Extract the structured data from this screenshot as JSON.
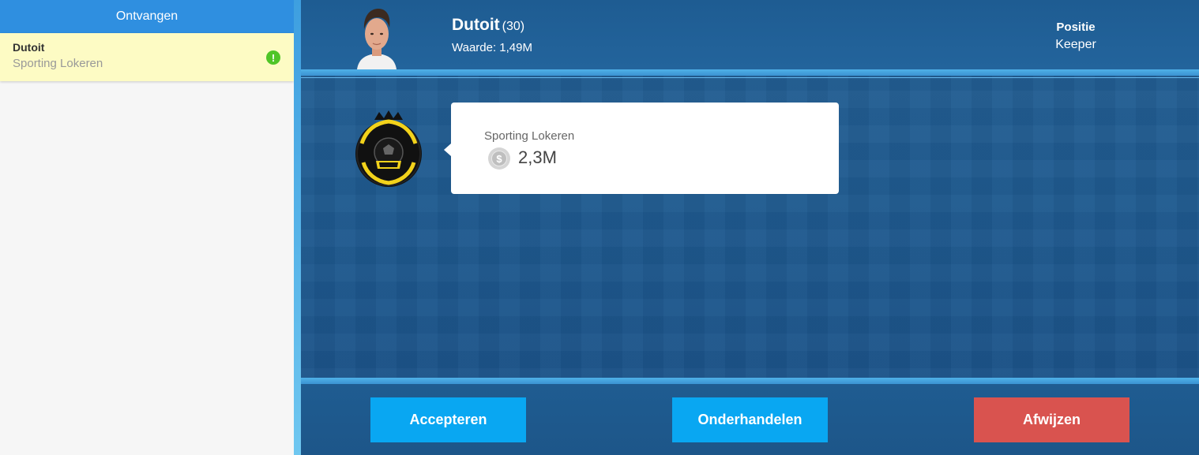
{
  "sidebar": {
    "header": "Ontvangen",
    "items": [
      {
        "name": "Dutoit",
        "club": "Sporting Lokeren",
        "status_icon": "alert-icon"
      }
    ]
  },
  "player": {
    "name": "Dutoit",
    "age": "(30)",
    "value_text": "Waarde: 1,49M",
    "position_label": "Positie",
    "position_value": "Keeper"
  },
  "offer": {
    "club": "Sporting Lokeren",
    "amount": "2,3M",
    "currency_icon": "coin-icon"
  },
  "actions": {
    "accept": "Accepteren",
    "negotiate": "Onderhandelen",
    "reject": "Afwijzen"
  },
  "colors": {
    "sidebar_header": "#2f8fe0",
    "selected_item": "#fdfbc4",
    "alert": "#4fc527",
    "primary_button": "#09a7f2",
    "reject_button": "#d9534f",
    "main_background": "#1f5a8f"
  }
}
